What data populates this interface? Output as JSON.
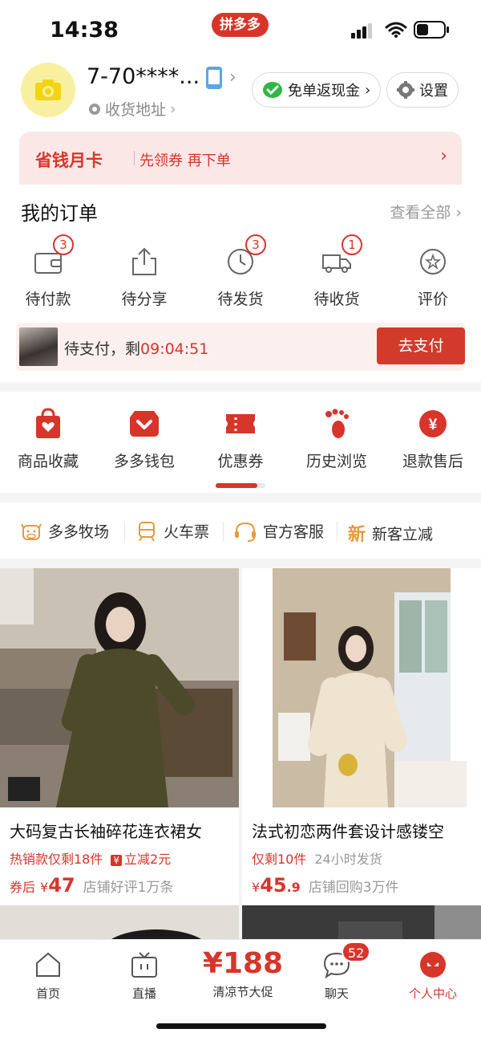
{
  "status_bar": {
    "time": "14:38",
    "app_name": "拼多多"
  },
  "header": {
    "username": "7-70****...",
    "address_label": "收货地址",
    "cashback_label": "免单返现金",
    "settings_label": "设置"
  },
  "promo_card": {
    "title": "省钱月卡",
    "subtitle": "先领券 再下单"
  },
  "orders": {
    "title": "我的订单",
    "see_all": "查看全部",
    "items": [
      {
        "label": "待付款",
        "badge": "3",
        "icon": "wallet-icon"
      },
      {
        "label": "待分享",
        "badge": "",
        "icon": "share-icon"
      },
      {
        "label": "待发货",
        "badge": "3",
        "icon": "clock-icon"
      },
      {
        "label": "待收货",
        "badge": "1",
        "icon": "truck-icon"
      },
      {
        "label": "评价",
        "badge": "",
        "icon": "review-icon"
      }
    ],
    "pending": {
      "prefix": "待支付，剩",
      "countdown": "09:04:51",
      "button": "去支付"
    }
  },
  "tools": {
    "items": [
      {
        "label": "商品收藏",
        "icon": "favorites-bag-icon"
      },
      {
        "label": "多多钱包",
        "icon": "wallet-heart-icon"
      },
      {
        "label": "优惠券",
        "icon": "coupon-icon"
      },
      {
        "label": "历史浏览",
        "icon": "footprint-icon"
      },
      {
        "label": "退款售后",
        "icon": "refund-yen-icon"
      }
    ],
    "scroll_progress": 0.84
  },
  "shortcuts": [
    {
      "label": "多多牧场",
      "icon": "cow-icon"
    },
    {
      "label": "火车票",
      "icon": "train-icon"
    },
    {
      "label": "官方客服",
      "icon": "headset-icon"
    },
    {
      "label": "新客立减",
      "icon": "new-icon",
      "icon_text": "新"
    }
  ],
  "products": [
    {
      "title": "大码复古长袖碎花连衣裙女",
      "tag1": "热销款仅剩18件",
      "tag2": "立减2元",
      "price_prefix": "券后",
      "currency": "¥",
      "price": "47",
      "price_decimal": "",
      "meta": "店铺好评1万条"
    },
    {
      "title": "法式初恋两件套设计感镂空",
      "tag1": "仅剩10件",
      "tag2": "24小时发货",
      "price_prefix": "",
      "currency": "¥",
      "price": "45",
      "price_decimal": ".9",
      "meta": "店铺回购3万件"
    }
  ],
  "bottom_nav": {
    "home": "首页",
    "live": "直播",
    "promo_amount": "¥188",
    "promo_label": "清凉节大促",
    "chat": "聊天",
    "chat_badge": "52",
    "profile": "个人中心"
  },
  "colors": {
    "accent": "#d8352a",
    "promo_bg": "#fbe8e6"
  }
}
